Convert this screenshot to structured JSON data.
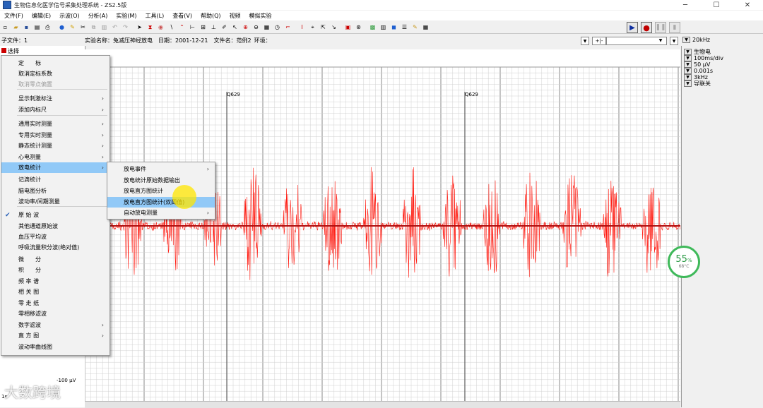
{
  "window": {
    "title": "生物信息化医学信号采集处理系统 - ZS2.5版",
    "minimize": "─",
    "maximize": "☐",
    "close": "✕"
  },
  "menubar": [
    "文件(F)",
    "编辑(E)",
    "示波(O)",
    "分析(A)",
    "实验(M)",
    "工具(L)",
    "查看(V)",
    "帮助(Q)",
    "视频",
    "模拟实验"
  ],
  "infobar": {
    "subfile": "子文件：1",
    "experiment": "实验名称：兔减压神经放电",
    "date": "日期：2001-12-21",
    "filename": "文件名：范例2",
    "environment": "环境："
  },
  "left": {
    "select_label": "选择",
    "bottom_value": "-100 µV",
    "time_start": "1s"
  },
  "context_menu": [
    {
      "label": "定　　标",
      "disabled": false,
      "arrow": false
    },
    {
      "label": "取消定标系数",
      "disabled": false,
      "arrow": false
    },
    {
      "label": "取消零点偏置",
      "disabled": true,
      "arrow": false
    },
    {
      "label": "显示刺激标注",
      "disabled": false,
      "arrow": true
    },
    {
      "label": "添加内标尺",
      "disabled": false,
      "arrow": true
    },
    {
      "label": "通用实时测量",
      "disabled": false,
      "arrow": true
    },
    {
      "label": "专用实时测量",
      "disabled": false,
      "arrow": true
    },
    {
      "label": "静态统计测量",
      "disabled": false,
      "arrow": true
    },
    {
      "label": "心电测量",
      "disabled": false,
      "arrow": true
    },
    {
      "label": "放电统计",
      "disabled": false,
      "arrow": true,
      "highlight": true
    },
    {
      "label": "记滴统计",
      "disabled": false,
      "arrow": false
    },
    {
      "label": "脑电图分析",
      "disabled": false,
      "arrow": false
    },
    {
      "label": "波动率/间期测量",
      "disabled": false,
      "arrow": false
    },
    {
      "label": "原 始 波",
      "disabled": false,
      "arrow": false,
      "checked": true
    },
    {
      "label": "其他通道原始波",
      "disabled": false,
      "arrow": false
    },
    {
      "label": "血压平均波",
      "disabled": false,
      "arrow": false
    },
    {
      "label": "呼吸流量积分波(绝对值)",
      "disabled": false,
      "arrow": false
    },
    {
      "label": "微　　分",
      "disabled": false,
      "arrow": false
    },
    {
      "label": "积　　分",
      "disabled": false,
      "arrow": false
    },
    {
      "label": "频 率 谱",
      "disabled": false,
      "arrow": false
    },
    {
      "label": "相 关 图",
      "disabled": false,
      "arrow": false
    },
    {
      "label": "零 走 纸",
      "disabled": false,
      "arrow": false
    },
    {
      "label": "零相移滤波",
      "disabled": false,
      "arrow": false
    },
    {
      "label": "数字滤波",
      "disabled": false,
      "arrow": true
    },
    {
      "label": "直 方 图",
      "disabled": false,
      "arrow": true
    },
    {
      "label": "波动率曲线图",
      "disabled": false,
      "arrow": false
    }
  ],
  "submenu": [
    {
      "label": "放电事件",
      "arrow": true
    },
    {
      "label": "放电统计原始数据输出",
      "arrow": false
    },
    {
      "label": "放电直方图统计",
      "arrow": false
    },
    {
      "label": "放电直方图统计(双阈值)",
      "arrow": false,
      "highlight": true
    },
    {
      "label": "自动放电测量",
      "arrow": true
    }
  ],
  "markers": [
    "Q629",
    "Q629"
  ],
  "right_panel": {
    "sample_rate": "20kHz",
    "channel": "生物电",
    "timebase": "100ms/div",
    "gain": "50 µV",
    "time_const": "0.001s",
    "filter": "3kHz",
    "notch": "导联关"
  },
  "perf": {
    "value": "55",
    "unit": "%",
    "temp": "68°C"
  },
  "watermark": "大数跨境",
  "colors": {
    "signal": "#ff1a10",
    "baseline": "#b01010",
    "menu_highlight": "#91c9f7",
    "grid": "#c8c8c8"
  }
}
